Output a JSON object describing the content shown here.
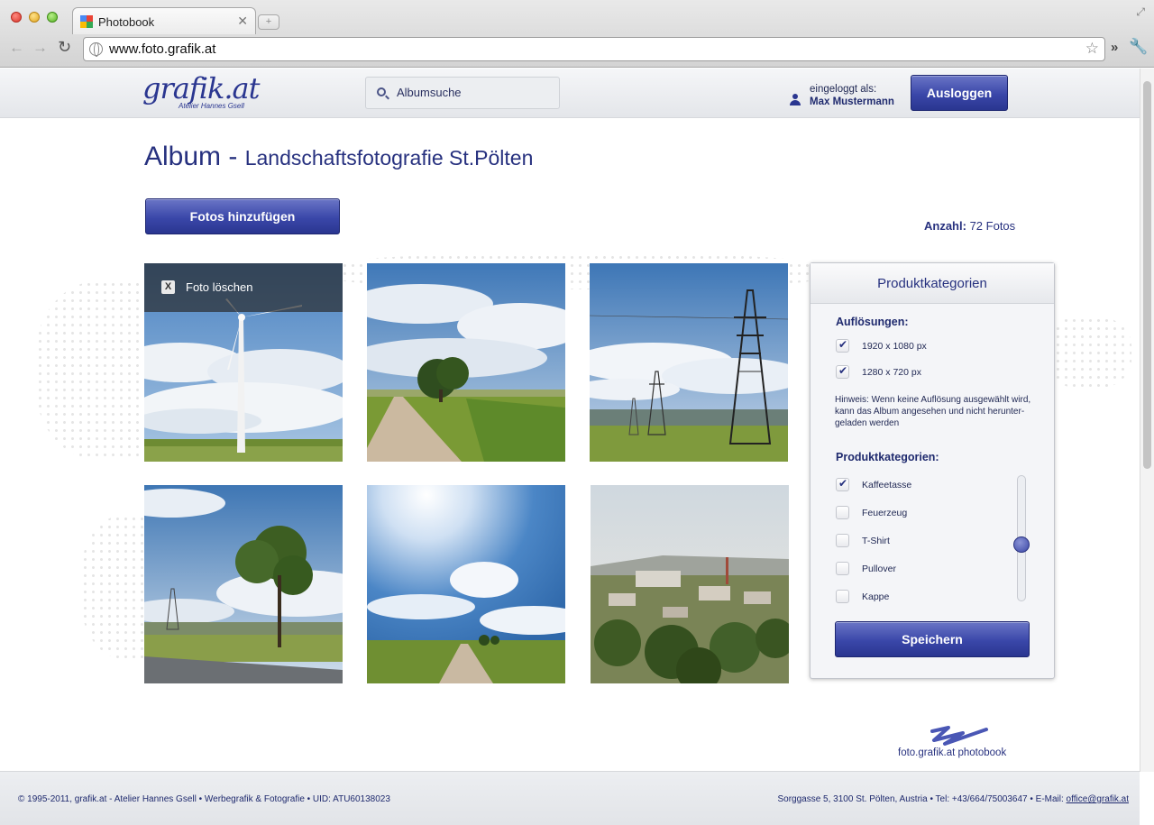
{
  "browser": {
    "tab_title": "Photobook",
    "new_tab_symbol": "+",
    "url": "www.foto.grafik.at"
  },
  "header": {
    "logo_text": "grafik.at",
    "logo_subtitle": "Atelier Hannes Gsell",
    "search_placeholder": "Albumsuche",
    "login_label": "eingeloggt als:",
    "user_name": "Max Mustermann",
    "logout_label": "Ausloggen"
  },
  "album": {
    "title_prefix": "Album",
    "title_separator": " - ",
    "title_name": "Landschaftsfotografie St.Pölten",
    "add_photos_label": "Fotos hinzufügen",
    "count_label": "Anzahl:",
    "count_value": "72 Fotos",
    "delete_label": "Foto löschen",
    "delete_symbol": "X"
  },
  "photos": [
    {
      "name": "windrad",
      "subject": "wind turbine in field"
    },
    {
      "name": "feldweg-baum",
      "subject": "dirt road with tree"
    },
    {
      "name": "strommast",
      "subject": "power pylons"
    },
    {
      "name": "baum-strasse",
      "subject": "tree by road"
    },
    {
      "name": "sonne-weg",
      "subject": "sun over path"
    },
    {
      "name": "stadt",
      "subject": "town view"
    }
  ],
  "panel": {
    "title": "Produktkategorien",
    "resolutions_heading": "Auflösungen:",
    "resolutions": [
      {
        "label": "1920 x 1080 px",
        "checked": true
      },
      {
        "label": "1280 x 720 px",
        "checked": true
      }
    ],
    "hint": "Hinweis: Wenn keine Auflösung ausgewählt wird, kann das Album angesehen und nicht herunter- geladen werden",
    "categories_heading": "Produktkategorien:",
    "categories": [
      {
        "label": "Kaffeetasse",
        "checked": true
      },
      {
        "label": "Feuerzeug",
        "checked": false
      },
      {
        "label": "T-Shirt",
        "checked": false
      },
      {
        "label": "Pullover",
        "checked": false
      },
      {
        "label": "Kappe",
        "checked": false
      }
    ],
    "slider_level": 0.55,
    "save_label": "Speichern"
  },
  "brand_text": "foto.grafik.at photobook",
  "footer": {
    "left": "© 1995-2011, grafik.at - Atelier Hannes Gsell • Werbegrafik & Fotografie • UID: ATU60138023",
    "right_text": "Sorggasse 5, 3100 St. Pölten, Austria • Tel: +43/664/75003647 • E-Mail: ",
    "email": "office@grafik.at"
  },
  "colors": {
    "brand_blue": "#2a3690",
    "text_blue": "#27317f"
  }
}
